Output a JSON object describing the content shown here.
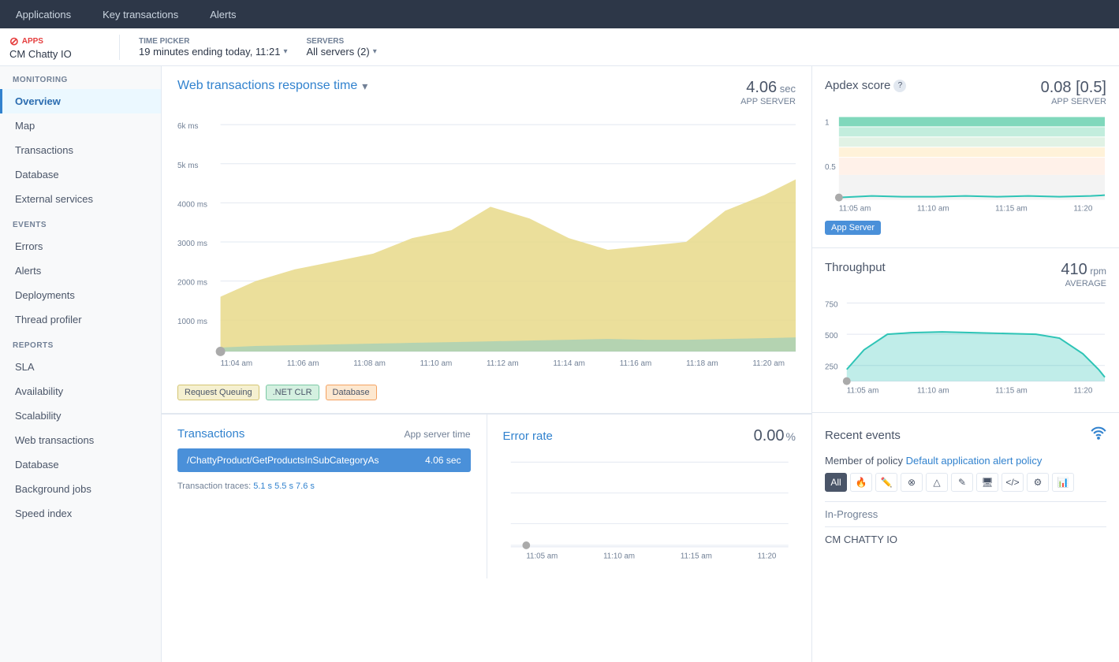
{
  "topNav": {
    "items": [
      "Applications",
      "Key transactions",
      "Alerts"
    ]
  },
  "subHeader": {
    "apps_label": "APPS",
    "app_name": "CM Chatty IO",
    "time_picker_label": "TIME PICKER",
    "time_picker_value": "19 minutes ending today, 11:21",
    "servers_label": "SERVERS",
    "servers_value": "All servers (2)"
  },
  "sidebar": {
    "monitoring_label": "MONITORING",
    "monitoring_items": [
      {
        "label": "Overview",
        "active": true
      },
      {
        "label": "Map",
        "active": false
      },
      {
        "label": "Transactions",
        "active": false
      },
      {
        "label": "Database",
        "active": false
      },
      {
        "label": "External services",
        "active": false
      }
    ],
    "events_label": "EVENTS",
    "events_items": [
      {
        "label": "Errors",
        "active": false
      },
      {
        "label": "Alerts",
        "active": false
      },
      {
        "label": "Deployments",
        "active": false
      },
      {
        "label": "Thread profiler",
        "active": false
      }
    ],
    "reports_label": "REPORTS",
    "reports_items": [
      {
        "label": "SLA",
        "active": false
      },
      {
        "label": "Availability",
        "active": false
      },
      {
        "label": "Scalability",
        "active": false
      },
      {
        "label": "Web transactions",
        "active": false
      },
      {
        "label": "Database",
        "active": false
      },
      {
        "label": "Background jobs",
        "active": false
      },
      {
        "label": "Speed index",
        "active": false
      }
    ]
  },
  "mainChart": {
    "title": "Web transactions response time",
    "stat_value": "4.06",
    "stat_unit": "sec",
    "stat_label": "APP SERVER",
    "y_labels": [
      "6k ms",
      "5k ms",
      "4000 ms",
      "3000 ms",
      "2000 ms",
      "1000 ms"
    ],
    "x_labels": [
      "11:04 am",
      "11:06 am",
      "11:08 am",
      "11:10 am",
      "11:12 am",
      "11:14 am",
      "11:16 am",
      "11:18 am",
      "11:20 am"
    ],
    "legend": [
      {
        "label": "Request Queuing",
        "color": "#d4c571"
      },
      {
        "label": ".NET CLR",
        "color": "#7bc8a4"
      },
      {
        "label": "Database",
        "color": "#f4a261"
      }
    ]
  },
  "transactions": {
    "title": "Transactions",
    "subtitle": "App server time",
    "top_transaction": "/ChattyProduct/GetProductsInSubCategoryAs",
    "top_transaction_time": "4.06 sec",
    "traces_label": "Transaction traces:",
    "trace_values": [
      "5.1 s",
      "5.5 s",
      "7.6 s"
    ]
  },
  "errorRate": {
    "title": "Error rate",
    "value": "0.00",
    "unit": "%",
    "x_labels": [
      "11:05 am",
      "11:10 am",
      "11:15 am",
      "11:20"
    ]
  },
  "apdex": {
    "title": "Apdex score",
    "info_icon": "?",
    "value": "0.08 [0.5]",
    "label": "APP SERVER",
    "badge": "App Server",
    "y_labels": [
      "1",
      "0.5"
    ],
    "x_labels": [
      "11:05 am",
      "11:10 am",
      "11:15 am",
      "11:20"
    ]
  },
  "throughput": {
    "title": "Throughput",
    "value": "410",
    "unit": "rpm",
    "avg_label": "AVERAGE",
    "y_labels": [
      "750",
      "500",
      "250"
    ],
    "x_labels": [
      "11:05 am",
      "11:10 am",
      "11:15 am",
      "11:20"
    ]
  },
  "recentEvents": {
    "title": "Recent events",
    "policy_text": "Member of policy",
    "policy_link": "Default application alert policy",
    "in_progress": "In-Progress",
    "cm_chatty": "CM CHATTY IO",
    "filters": [
      "All",
      "🔥",
      "✏️",
      "⊗",
      "△",
      "✎",
      "🖥",
      "</>",
      "⚙️",
      "📊"
    ]
  }
}
